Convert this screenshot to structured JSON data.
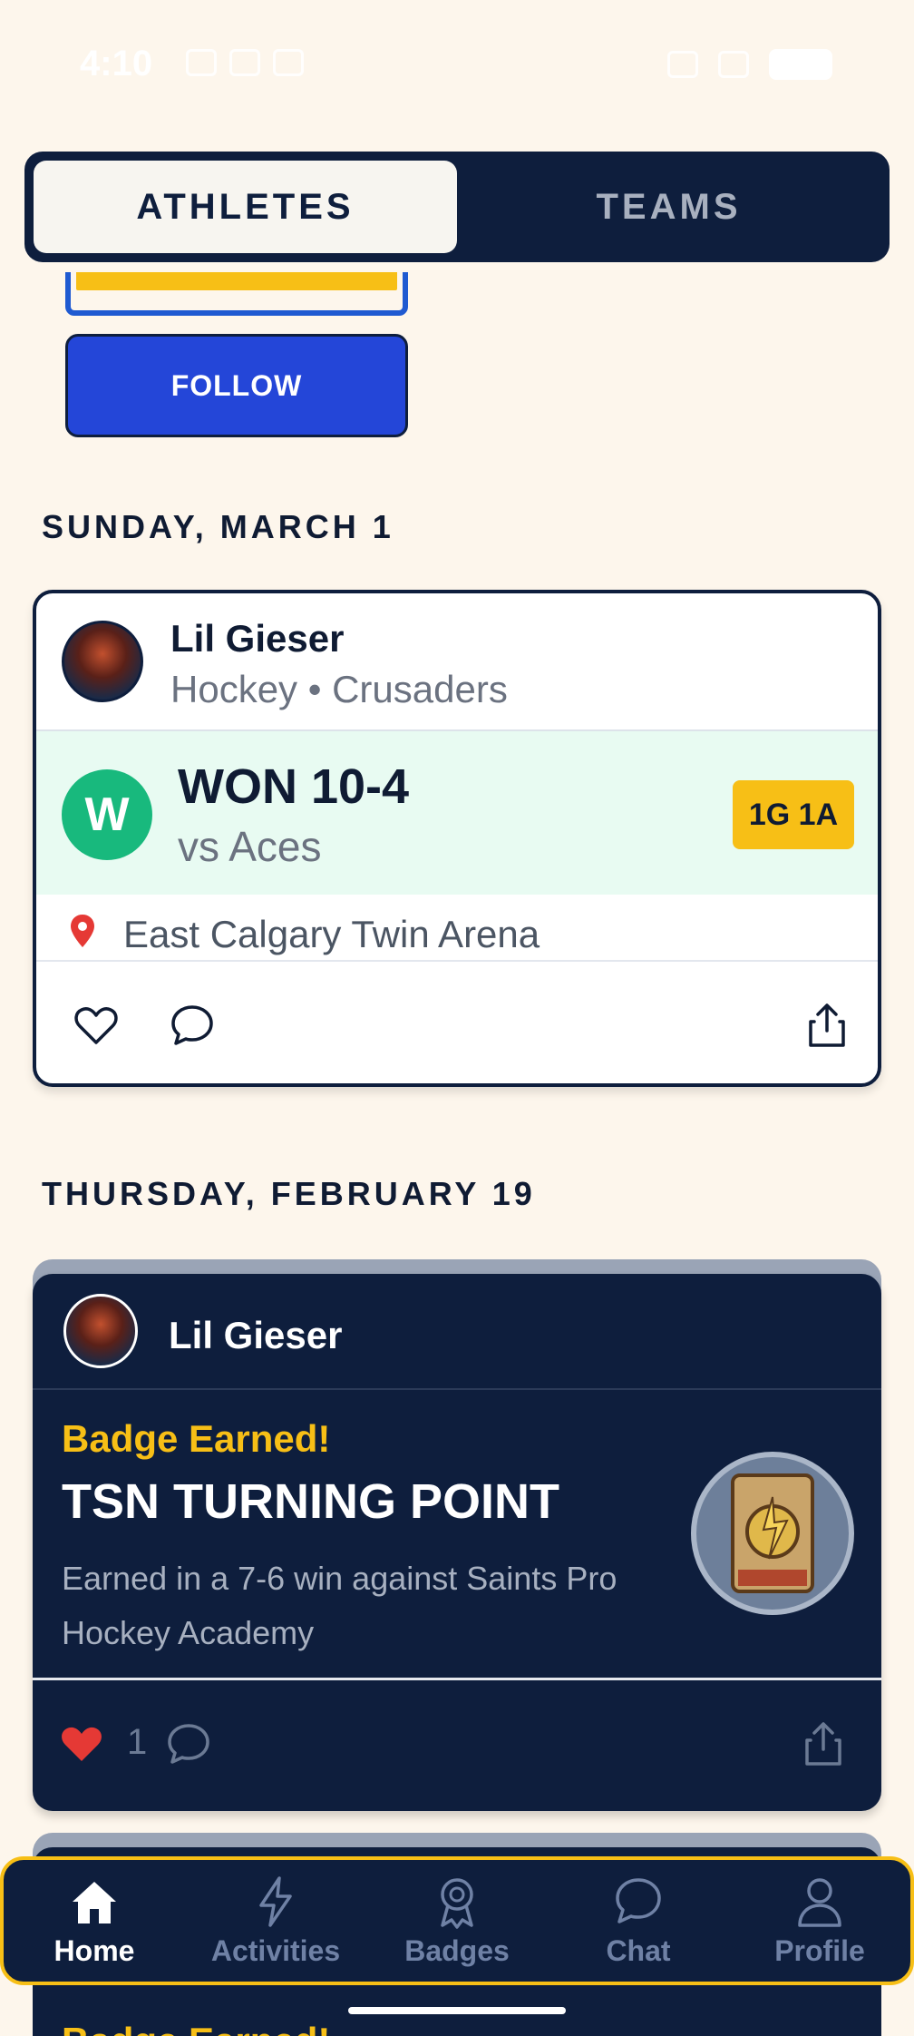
{
  "status_bar": {
    "time": "4:10"
  },
  "segment": {
    "athletes": "ATHLETES",
    "teams": "TEAMS"
  },
  "follow_label": "FOLLOW",
  "sections": [
    {
      "date": "SUNDAY, MARCH 1"
    },
    {
      "date": "THURSDAY, FEBRUARY 19"
    }
  ],
  "game_card": {
    "athlete": "Lil Gieser",
    "subtitle": "Hockey • Crusaders",
    "result_letter": "W",
    "score": "WON 10-4",
    "opponent": "vs Aces",
    "stats": "1G 1A",
    "location": "East Calgary Twin Arena"
  },
  "badge_card": {
    "athlete": "Lil Gieser",
    "badge_earned": "Badge Earned!",
    "badge_title": "TSN TURNING POINT",
    "description": "Earned in a 7-6 win against Saints Pro Hockey Academy",
    "like_count": "1"
  },
  "next_card": {
    "badge_earned": "Badge Earned!"
  },
  "nav": {
    "home": "Home",
    "activities": "Activities",
    "badges": "Badges",
    "chat": "Chat",
    "profile": "Profile"
  },
  "colors": {
    "navy": "#0e1e3d",
    "gold": "#f7bf16",
    "win_green": "#18b97d",
    "follow_blue": "#2446d8",
    "like_red": "#e53935"
  }
}
